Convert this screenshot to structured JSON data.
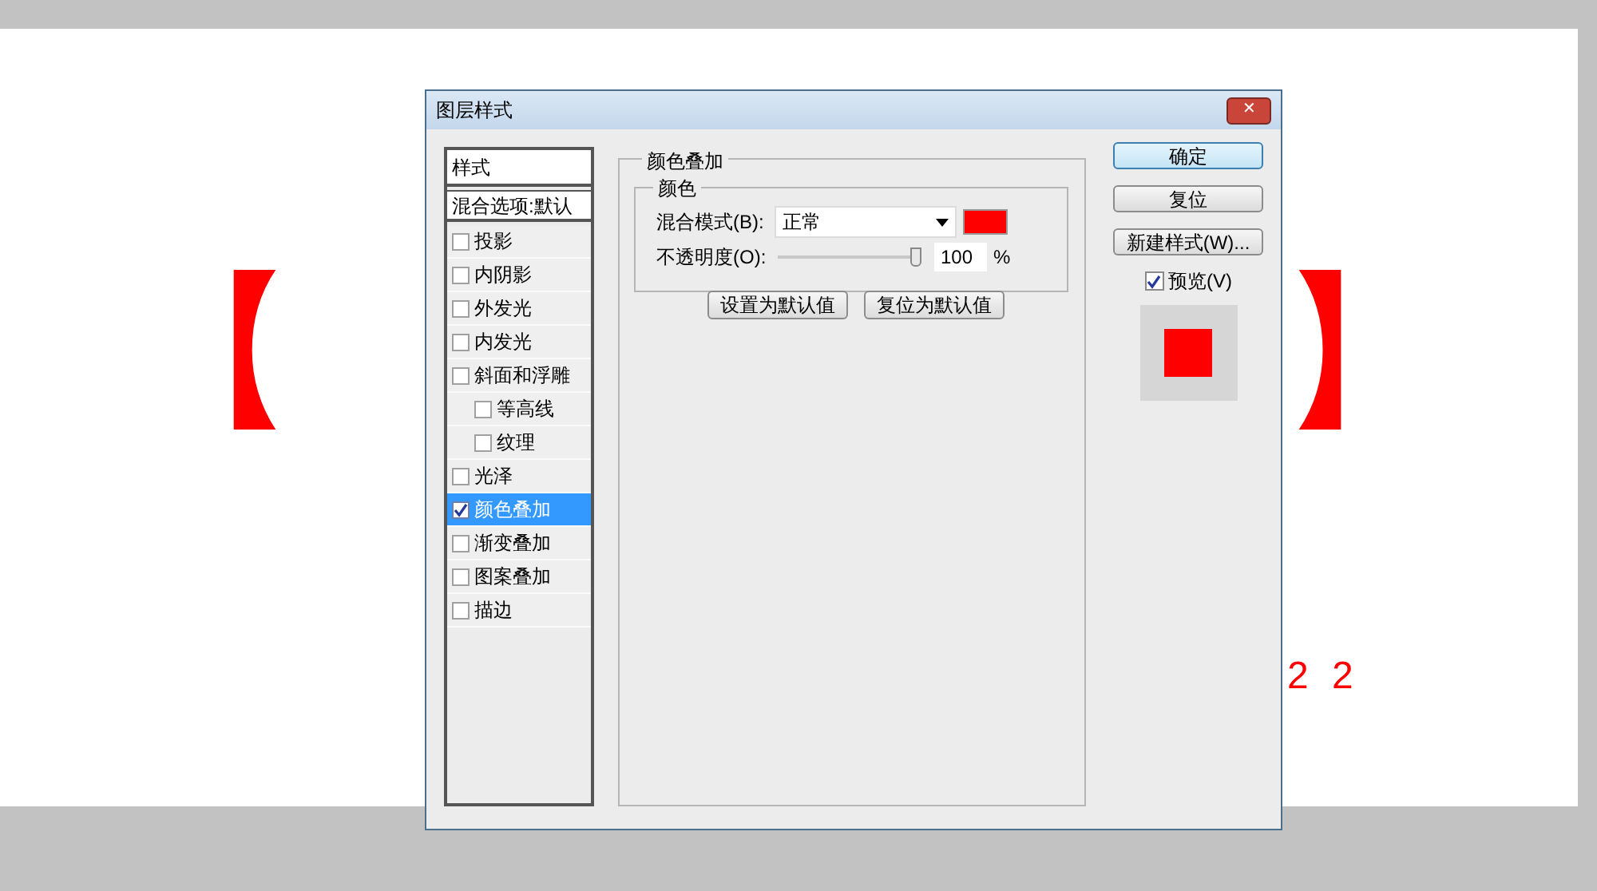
{
  "canvas": {
    "texts": [
      {
        "text": "【",
        "kind": "big"
      },
      {
        "text": "】",
        "kind": "big"
      },
      {
        "text": "2 2",
        "kind": "small"
      }
    ]
  },
  "dialog": {
    "title": "图层样式",
    "close": "✕",
    "styles": {
      "header": "样式",
      "blend_options": "混合选项:默认",
      "items": [
        {
          "label": "投影",
          "checked": false,
          "selected": false
        },
        {
          "label": "内阴影",
          "checked": false,
          "selected": false
        },
        {
          "label": "外发光",
          "checked": false,
          "selected": false
        },
        {
          "label": "内发光",
          "checked": false,
          "selected": false
        },
        {
          "label": "斜面和浮雕",
          "checked": false,
          "selected": false,
          "children": [
            {
              "label": "等高线",
              "checked": false,
              "selected": false
            },
            {
              "label": "纹理",
              "checked": false,
              "selected": false
            }
          ]
        },
        {
          "label": "光泽",
          "checked": false,
          "selected": false
        },
        {
          "label": "颜色叠加",
          "checked": true,
          "selected": true
        },
        {
          "label": "渐变叠加",
          "checked": false,
          "selected": false
        },
        {
          "label": "图案叠加",
          "checked": false,
          "selected": false
        },
        {
          "label": "描边",
          "checked": false,
          "selected": false
        }
      ]
    },
    "panel": {
      "title": "颜色叠加",
      "group": "颜色",
      "blend_mode": {
        "label": "混合模式(B):",
        "value": "正常",
        "color": "#ff0000"
      },
      "opacity": {
        "label": "不透明度(O):",
        "level": 1.0,
        "value": "100",
        "unit": "%"
      },
      "buttons": [
        "设置为默认值",
        "复位为默认值"
      ]
    },
    "side_buttons": [
      {
        "label": "确定",
        "default": true
      },
      {
        "label": "复位",
        "default": false
      },
      {
        "label": "新建样式(W)...",
        "default": false
      }
    ],
    "preview": {
      "label": "预览(V)",
      "checked": true,
      "color": "#ff0000"
    }
  }
}
